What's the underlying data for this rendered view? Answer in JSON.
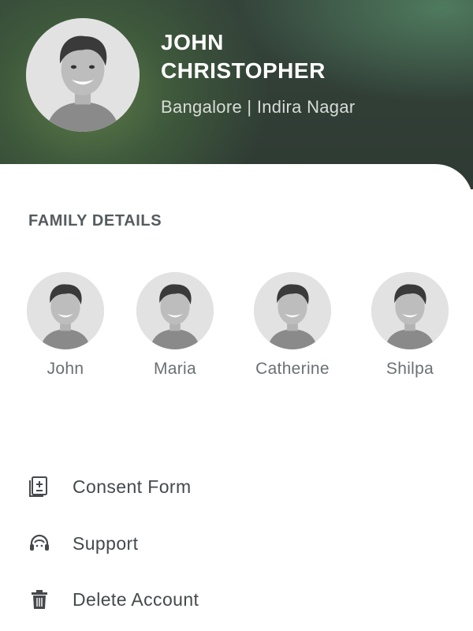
{
  "profile": {
    "first_name": "JOHN",
    "last_name": "CHRISTOPHER",
    "location": "Bangalore | Indira Nagar",
    "avatar_icon": "user-photo-icon"
  },
  "family": {
    "title": "FAMILY DETAILS",
    "members": [
      {
        "name": "John"
      },
      {
        "name": "Maria"
      },
      {
        "name": "Catherine"
      },
      {
        "name": "Shilpa"
      }
    ]
  },
  "menu": {
    "items": [
      {
        "label": "Consent Form",
        "icon": "consent-form-icon"
      },
      {
        "label": "Support",
        "icon": "support-icon"
      },
      {
        "label": "Delete Account",
        "icon": "trash-icon"
      }
    ]
  },
  "colors": {
    "header_bg": "#2e3a33",
    "header_glow": "#5f7d4a",
    "name_text": "#ffffff",
    "location_text": "#d8dcd8",
    "section_title": "#555b5e",
    "member_name": "#6b7073",
    "menu_text": "#45494c"
  }
}
